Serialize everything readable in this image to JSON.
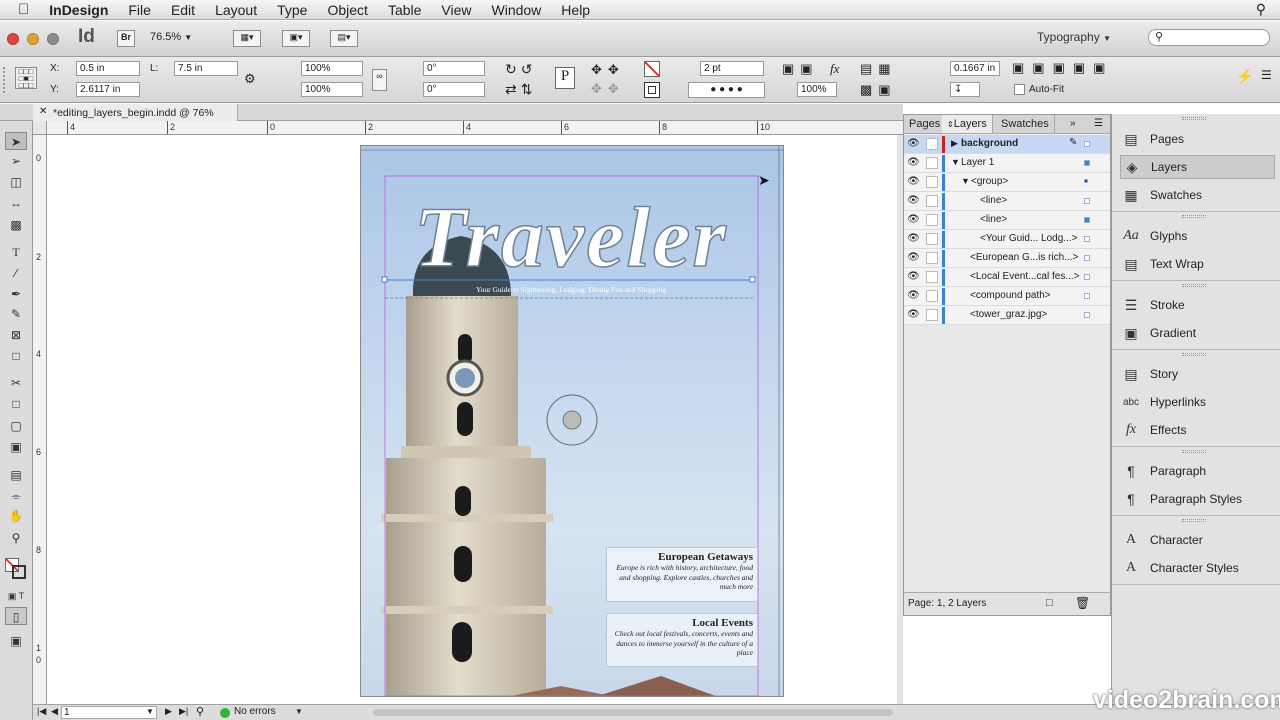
{
  "menubar": {
    "apple": "",
    "app": "InDesign",
    "items": [
      "File",
      "Edit",
      "Layout",
      "Type",
      "Object",
      "Table",
      "View",
      "Window",
      "Help"
    ]
  },
  "appbar": {
    "logo": "Id",
    "bridge": "Br",
    "zoom": "76.5%",
    "workspace": "Typography"
  },
  "control": {
    "x": "0.5 in",
    "y": "2.6117 in",
    "l": "7.5 in",
    "scale_x": "100%",
    "scale_y": "100%",
    "rot": "0°",
    "shear": "0°",
    "stroke_weight": "2 pt",
    "opacity": "100%",
    "gap": "0.1667 in",
    "autofit": "Auto-Fit",
    "x_label": "X:",
    "y_label": "Y:",
    "l_label": "L:"
  },
  "doc_tab": {
    "title": "*editing_layers_begin.indd @ 76%"
  },
  "ruler": {
    "h": [
      "4",
      "2",
      "0",
      "2",
      "4",
      "6",
      "8",
      "10"
    ],
    "v": [
      "0",
      "2",
      "4",
      "6",
      "8",
      "1",
      "0"
    ]
  },
  "page": {
    "title": "Traveler",
    "tagline": "Your Guide to Sightseeing, Lodging, Dining Fun and Shopping",
    "box1_title": "European Getaways",
    "box1_body": "Europe is rich with history, architecture, food and shopping. Explore castles, churches and much more",
    "box2_title": "Local Events",
    "box2_body": "Check out local festivals, concerts, events and dances to immerse yourself in the culture of a place"
  },
  "layers_panel": {
    "tabs": [
      "Pages",
      "Layers",
      "Swatches"
    ],
    "rows": [
      {
        "name": "background"
      },
      {
        "name": "Layer 1"
      },
      {
        "name": "<group>"
      },
      {
        "name": "<line>"
      },
      {
        "name": "<line>"
      },
      {
        "name": "<Your Guid... Lodg...>"
      },
      {
        "name": "<European G...is rich...>"
      },
      {
        "name": "<Local Event...cal fes...>"
      },
      {
        "name": "<compound path>"
      },
      {
        "name": "<tower_graz.jpg>"
      }
    ],
    "footer": "Page: 1, 2 Layers"
  },
  "dock": {
    "items": [
      "Pages",
      "Layers",
      "Swatches",
      "Glyphs",
      "Text Wrap",
      "Stroke",
      "Gradient",
      "Story",
      "Hyperlinks",
      "Effects",
      "Paragraph",
      "Paragraph Styles",
      "Character",
      "Character Styles"
    ]
  },
  "status": {
    "page": "1",
    "errors": "No errors"
  },
  "watermark": "video2brain.com",
  "colors": {
    "accent": "#3d7fd6",
    "layer_red": "#cc2222",
    "layer_blue": "#3d7fd6",
    "errors_green": "#2fb52f"
  }
}
